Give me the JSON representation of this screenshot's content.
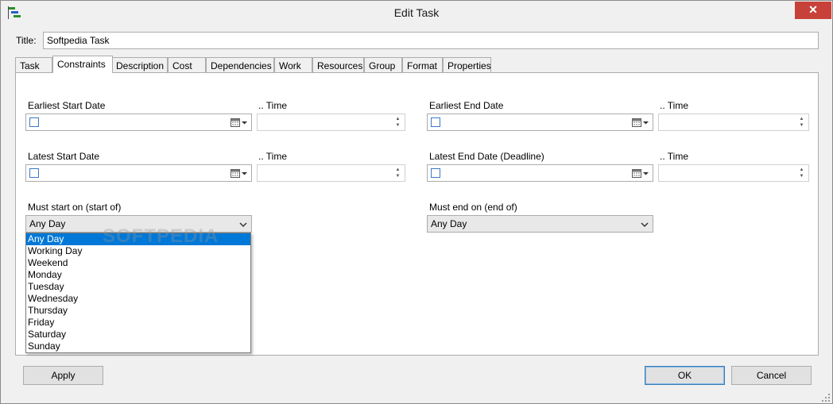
{
  "window": {
    "title": "Edit Task",
    "close_label": "✕"
  },
  "title_field": {
    "label": "Title:",
    "value": "Softpedia Task"
  },
  "tabs": [
    {
      "label": "Task"
    },
    {
      "label": "Constraints"
    },
    {
      "label": "Description"
    },
    {
      "label": "Cost"
    },
    {
      "label": "Dependencies"
    },
    {
      "label": "Work"
    },
    {
      "label": "Resources"
    },
    {
      "label": "Group"
    },
    {
      "label": "Format"
    },
    {
      "label": "Properties"
    }
  ],
  "constraints": {
    "earliest_start": {
      "label": "Earliest Start Date",
      "time_label": ".. Time"
    },
    "earliest_end": {
      "label": "Earliest End Date",
      "time_label": ".. Time"
    },
    "latest_start": {
      "label": "Latest Start Date",
      "time_label": ".. Time"
    },
    "latest_end": {
      "label": "Latest End  Date (Deadline)",
      "time_label": ".. Time"
    },
    "must_start": {
      "label": "Must start on (start of)",
      "value": "Any Day"
    },
    "must_end": {
      "label": "Must end on (end of)",
      "value": "Any Day"
    }
  },
  "dropdown_options": [
    "Any Day",
    "Working Day",
    "Weekend",
    "Monday",
    "Tuesday",
    "Wednesday",
    "Thursday",
    "Friday",
    "Saturday",
    "Sunday"
  ],
  "watermark": "SOFTPEDIA",
  "buttons": {
    "apply": "Apply",
    "ok": "OK",
    "cancel": "Cancel"
  },
  "colors": {
    "selection": "#0078d7",
    "close": "#c7413a"
  }
}
